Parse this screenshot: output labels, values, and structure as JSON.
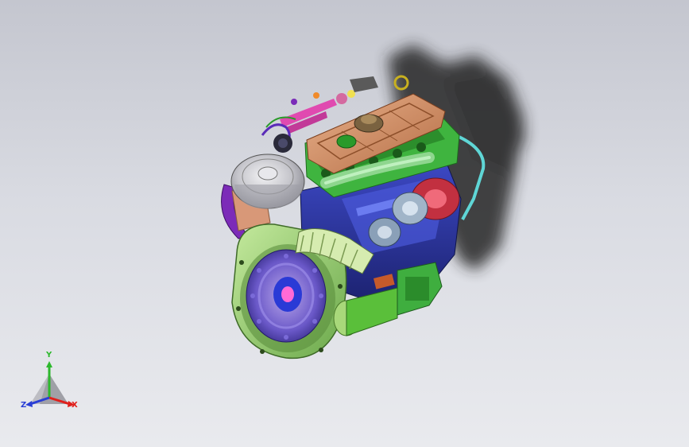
{
  "view": {
    "model": "engine-assembly",
    "background_top": "#c4c6cf",
    "background_bottom": "#e9eaee"
  },
  "triad": {
    "x_label": "X",
    "y_label": "Y",
    "z_label": "Z",
    "x_color": "#e0201c",
    "y_color": "#2db82d",
    "z_color": "#2a3fd6"
  },
  "colors": {
    "head_cover": "#d89868",
    "block_blue": "#2f3aa6",
    "flywheel_housing": "#9ccf76",
    "pipe_green": "#3fb43f",
    "air_filter": "#c8c8cc",
    "bracket_purple": "#7c2bb8",
    "turbo_red": "#c23040",
    "shadow": "#2b2b2b"
  }
}
